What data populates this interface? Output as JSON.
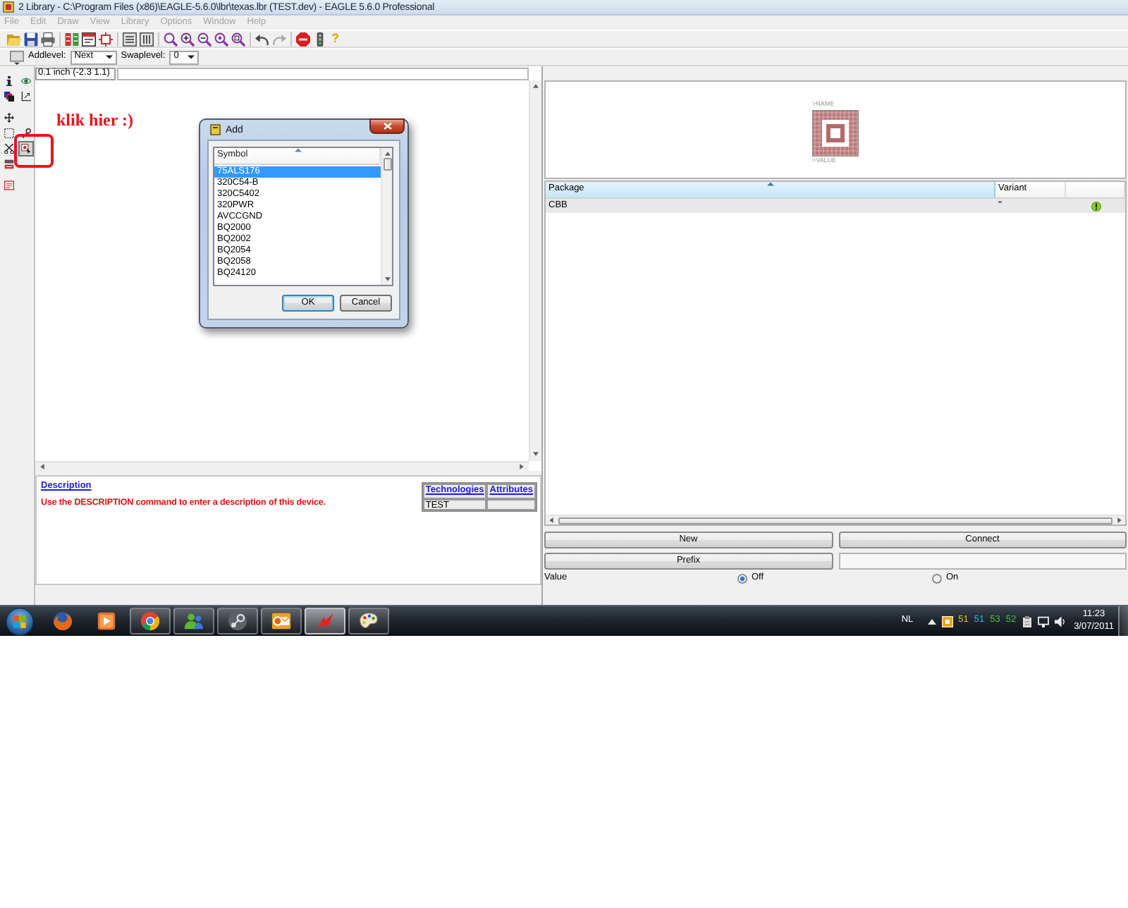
{
  "window": {
    "title": "2 Library - C:\\Program Files (x86)\\EAGLE-5.6.0\\lbr\\texas.lbr (TEST.dev) - EAGLE 5.6.0 Professional"
  },
  "menu": [
    {
      "label": "File",
      "disabled": true
    },
    {
      "label": "Edit",
      "disabled": true
    },
    {
      "label": "Draw",
      "disabled": true
    },
    {
      "label": "View",
      "disabled": true
    },
    {
      "label": "Library",
      "disabled": true
    },
    {
      "label": "Options",
      "disabled": true
    },
    {
      "label": "Window",
      "disabled": true
    },
    {
      "label": "Help",
      "disabled": true
    }
  ],
  "toolbar": {
    "help_glyph": "?"
  },
  "parameter_bar": {
    "addlevel_label": "Addlevel:",
    "addlevel_value": "Next",
    "swaplevel_label": "Swaplevel:",
    "swaplevel_value": "0"
  },
  "tool_groups": [
    [
      [
        {
          "kind": "info",
          "selected": false
        },
        {
          "kind": "show",
          "selected": false
        }
      ],
      [
        {
          "kind": "layers",
          "selected": false
        },
        {
          "kind": "mirror",
          "selected": false
        }
      ]
    ],
    [
      [
        {
          "kind": "move",
          "selected": false
        }
      ],
      [
        {
          "kind": "group",
          "selected": false
        },
        {
          "kind": "change",
          "selected": false
        }
      ],
      [
        {
          "kind": "cut",
          "selected": false
        },
        {
          "kind": "add",
          "selected": true
        }
      ],
      [
        {
          "kind": "paste",
          "selected": false
        }
      ]
    ],
    [
      [
        {
          "kind": "technologies",
          "selected": false
        }
      ]
    ]
  ],
  "canvas": {
    "coordinates": "0.1 inch (-2.3 1.1)"
  },
  "annotation": {
    "text": "klik hier :)"
  },
  "description": {
    "link": "Description",
    "text": "Use the DESCRIPTION command to enter a description of this device.",
    "table": {
      "columns": [
        "Technologies",
        "Attributes"
      ],
      "rows": [
        {
          "technology": "TEST"
        }
      ]
    }
  },
  "preview": {
    "name_label": ">NAME",
    "value_label": ">VALUE"
  },
  "package_table": {
    "columns": [
      {
        "label": "Package",
        "sorted": true
      },
      {
        "label": "Variant",
        "sorted": false
      }
    ],
    "rows": [
      {
        "package": "CBB",
        "variant": "''",
        "selected": true
      }
    ]
  },
  "buttons": [
    {
      "label": "New"
    },
    {
      "label": "Connect"
    },
    {
      "label": "Prefix"
    }
  ],
  "value_row": {
    "label": "Value",
    "options": [
      {
        "label": "Off",
        "selected": true
      },
      {
        "label": "On",
        "selected": false
      }
    ]
  },
  "dialog": {
    "title": "Add",
    "list_header": "Symbol",
    "items": [
      {
        "label": "75ALS176",
        "selected": true
      },
      {
        "label": "320C54-B",
        "selected": false
      },
      {
        "label": "320C5402",
        "selected": false
      },
      {
        "label": "320PWR",
        "selected": false
      },
      {
        "label": "AVCCGND",
        "selected": false
      },
      {
        "label": "BQ2000",
        "selected": false
      },
      {
        "label": "BQ2002",
        "selected": false
      },
      {
        "label": "BQ2054",
        "selected": false
      },
      {
        "label": "BQ2058",
        "selected": false
      },
      {
        "label": "BQ24120",
        "selected": false
      }
    ],
    "buttons": [
      {
        "label": "OK",
        "default": true
      },
      {
        "label": "Cancel",
        "default": false
      }
    ]
  },
  "taskbar": {
    "apps": [
      {
        "kind": "globe",
        "running": false,
        "active": false
      },
      {
        "kind": "play",
        "running": false,
        "active": false
      },
      {
        "kind": "ring",
        "running": true,
        "active": false
      },
      {
        "kind": "people",
        "running": true,
        "active": false
      },
      {
        "kind": "disc",
        "running": true,
        "active": false
      },
      {
        "kind": "mail",
        "running": true,
        "active": false
      },
      {
        "kind": "bolt",
        "running": true,
        "active": true
      },
      {
        "kind": "palette",
        "running": true,
        "active": false
      }
    ],
    "language": "NL",
    "tray_counters": [
      {
        "text": "51",
        "color": "#e0c020"
      },
      {
        "text": "51",
        "color": "#3ab0e8"
      },
      {
        "text": "53",
        "color": "#4cc040"
      },
      {
        "text": "52",
        "color": "#4cc040"
      }
    ],
    "time": "11:23",
    "date": "3/07/2011"
  }
}
